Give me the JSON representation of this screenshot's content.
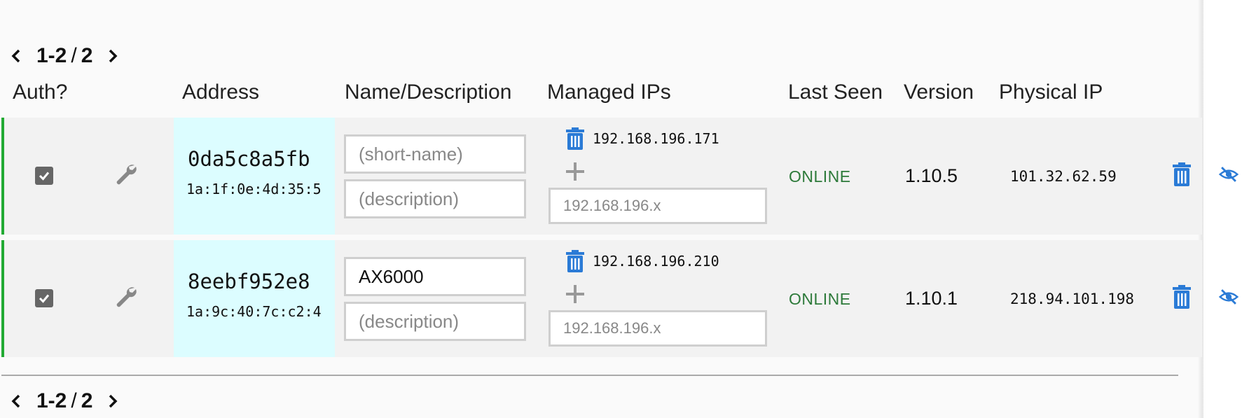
{
  "pager_top": {
    "range": "1-2",
    "total": "2"
  },
  "pager_bottom": {
    "range": "1-2",
    "total": "2"
  },
  "headers": {
    "auth": "Auth?",
    "address": "Address",
    "name_description": "Name/Description",
    "managed_ips": "Managed IPs",
    "last_seen": "Last Seen",
    "version": "Version",
    "physical_ip": "Physical IP"
  },
  "members": [
    {
      "authorized": true,
      "address": "0da5c8a5fb",
      "mac": "1a:1f:0e:4d:35:5",
      "name_value": "",
      "name_placeholder": "(short-name)",
      "description_value": "",
      "description_placeholder": "(description)",
      "managed_ip": "192.168.196.171",
      "new_ip_placeholder": "192.168.196.x",
      "status": "ONLINE",
      "version": "1.10.5",
      "physical_ip": "101.32.62.59"
    },
    {
      "authorized": true,
      "address": "8eebf952e8",
      "mac": "1a:9c:40:7c:c2:4",
      "name_value": "AX6000",
      "name_placeholder": "(short-name)",
      "description_value": "",
      "description_placeholder": "(description)",
      "managed_ip": "192.168.196.210",
      "new_ip_placeholder": "192.168.196.x",
      "status": "ONLINE",
      "version": "1.10.1",
      "physical_ip": "218.94.101.198"
    }
  ],
  "colors": {
    "accent_blue": "#2b7bd6",
    "online_green": "#2d7a3a",
    "row_border_green": "#22aa33",
    "address_bg": "#dcfdff"
  },
  "icons": {
    "prev": "chevron-left-icon",
    "next": "chevron-right-icon",
    "settings": "wrench-icon",
    "remove_ip": "trash-icon",
    "add_ip": "plus-icon",
    "delete_member": "trash-icon",
    "hide_member": "eye-slash-icon"
  }
}
